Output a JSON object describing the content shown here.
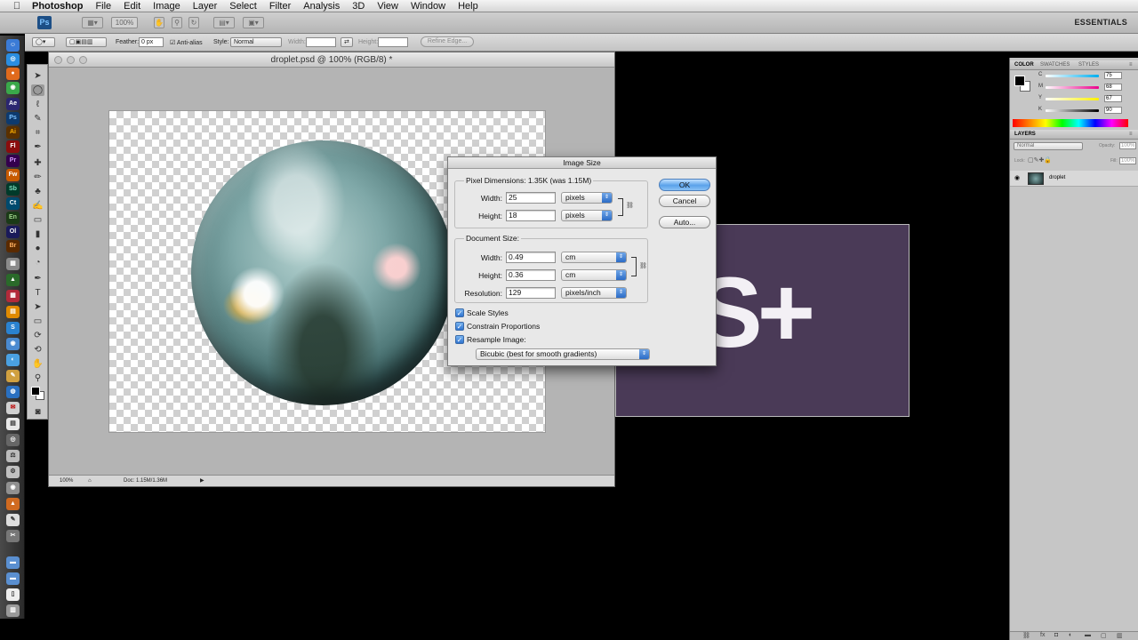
{
  "menubar": {
    "items": [
      "Photoshop",
      "File",
      "Edit",
      "Image",
      "Layer",
      "Select",
      "Filter",
      "Analysis",
      "3D",
      "View",
      "Window",
      "Help"
    ]
  },
  "appbar": {
    "logo": "Ps",
    "zoom": "100%",
    "workspace": "ESSENTIALS"
  },
  "options": {
    "feather_label": "Feather:",
    "feather_value": "0 px",
    "antialias_label": "Anti-alias",
    "style_label": "Style:",
    "style_value": "Normal",
    "width_label": "Width:",
    "height_label": "Height:",
    "refine_label": "Refine Edge..."
  },
  "dock": {
    "icons": [
      "finder-icon",
      "safari-icon",
      "firefox-icon",
      "chrome-icon",
      "after-effects-icon",
      "photoshop-icon",
      "illustrator-icon",
      "flash-icon",
      "premiere-icon",
      "fireworks-icon",
      "soundbooth-icon",
      "contribute-icon",
      "encore-icon",
      "onlocation-icon",
      "bridge-icon",
      "mail-icon"
    ]
  },
  "document": {
    "title": "droplet.psd @ 100% (RGB/8) *",
    "zoom": "100%",
    "doc_info": "Doc: 1.15M/1.36M"
  },
  "doc2": {
    "visible_text": "S+"
  },
  "dialog": {
    "title": "Image Size",
    "pixel_dimensions_label": "Pixel Dimensions: 1.35K (was 1.15M)",
    "pixel_width_label": "Width:",
    "pixel_width_value": "25",
    "pixel_width_unit": "pixels",
    "pixel_height_label": "Height:",
    "pixel_height_value": "18",
    "pixel_height_unit": "pixels",
    "document_size_label": "Document Size:",
    "doc_width_label": "Width:",
    "doc_width_value": "0.49",
    "doc_width_unit": "cm",
    "doc_height_label": "Height:",
    "doc_height_value": "0.36",
    "doc_height_unit": "cm",
    "resolution_label": "Resolution:",
    "resolution_value": "129",
    "resolution_unit": "pixels/inch",
    "scale_styles": "Scale Styles",
    "constrain_proportions": "Constrain Proportions",
    "resample_image": "Resample Image:",
    "resample_method": "Bicubic (best for smooth gradients)",
    "ok": "OK",
    "cancel": "Cancel",
    "auto": "Auto..."
  },
  "color_panel": {
    "tabs": [
      "COLOR",
      "SWATCHES",
      "STYLES"
    ],
    "sliders": [
      {
        "label": "C",
        "value": "75"
      },
      {
        "label": "M",
        "value": "68"
      },
      {
        "label": "Y",
        "value": "67"
      },
      {
        "label": "K",
        "value": "90"
      }
    ]
  },
  "layers_panel": {
    "title": "LAYERS",
    "blend_mode": "Normal",
    "opacity_label": "Opacity:",
    "opacity_value": "100%",
    "lock_label": "Lock:",
    "fill_label": "Fill:",
    "fill_value": "100%",
    "layers": [
      {
        "name": "droplet"
      }
    ]
  },
  "colors": {
    "dialog_bg": "#e8e8e8",
    "default_button": "#5aa2ea",
    "doc2_bg": "#4a3a57"
  }
}
